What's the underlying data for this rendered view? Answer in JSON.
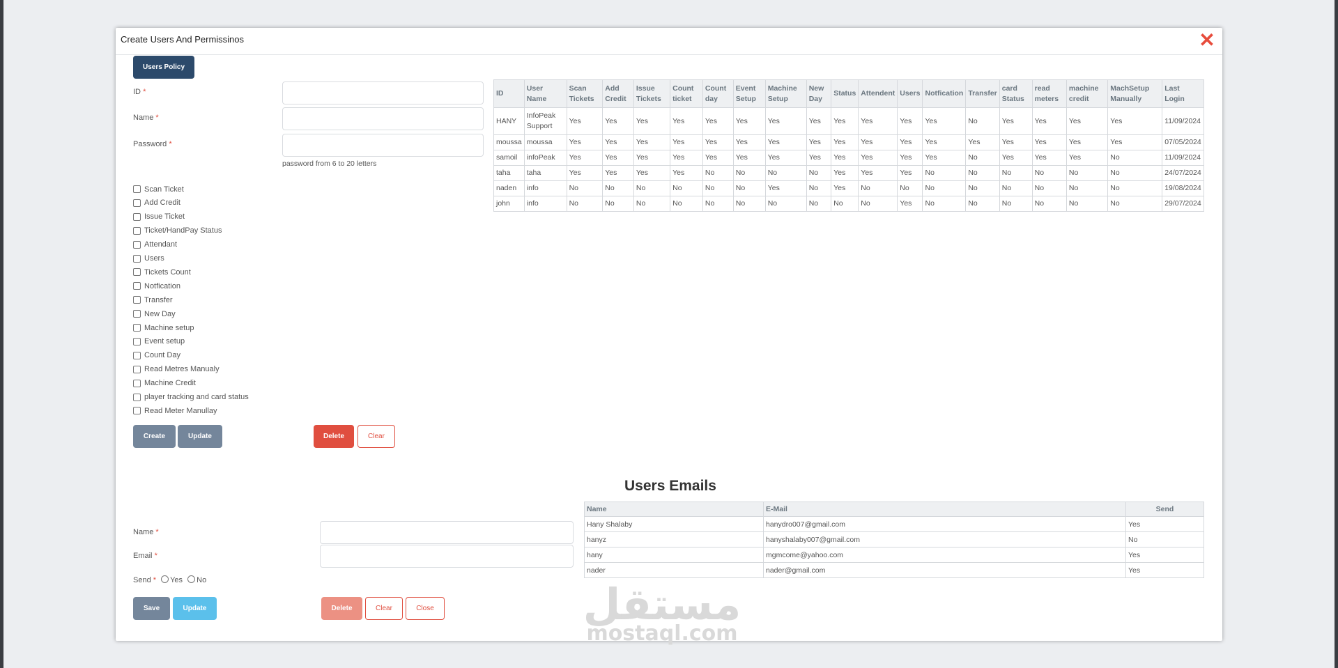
{
  "modal": {
    "title": "Create Users And Permissinos",
    "close_glyph": "✕"
  },
  "policy": {
    "tab_label": "Users Policy",
    "fields": {
      "id_label": "ID",
      "name_label": "Name",
      "password_label": "Password",
      "required_mark": "*",
      "password_hint": "password from 6 to 20 letters"
    },
    "permissions": [
      "Scan Ticket",
      "Add Credit",
      "Issue Ticket",
      "Ticket/HandPay Status",
      "Attendant",
      "Users",
      "Tickets Count",
      "Notfication",
      "Transfer",
      "New Day",
      "Machine setup",
      "Event setup",
      "Count Day",
      "Read Metres Manualy",
      "Machine Credit",
      "player tracking and card status",
      "Read Meter Manullay"
    ],
    "buttons": {
      "create": "Create",
      "update": "Update",
      "delete": "Delete",
      "clear": "Clear"
    }
  },
  "users_table": {
    "headers": [
      "ID",
      "User Name",
      "Scan Tickets",
      "Add Credit",
      "Issue Tickets",
      "Count ticket",
      "Count day",
      "Event Setup",
      "Machine Setup",
      "New Day",
      "Status",
      "Attendent",
      "Users",
      "Notfication",
      "Transfer",
      "card Status",
      "read meters",
      "machine credit",
      "MachSetup Manually",
      "Last Login"
    ],
    "rows": [
      [
        "HANY",
        "InfoPeak Support",
        "Yes",
        "Yes",
        "Yes",
        "Yes",
        "Yes",
        "Yes",
        "Yes",
        "Yes",
        "Yes",
        "Yes",
        "Yes",
        "Yes",
        "No",
        "Yes",
        "Yes",
        "Yes",
        "Yes",
        "11/09/2024"
      ],
      [
        "moussa",
        "moussa",
        "Yes",
        "Yes",
        "Yes",
        "Yes",
        "Yes",
        "Yes",
        "Yes",
        "Yes",
        "Yes",
        "Yes",
        "Yes",
        "Yes",
        "Yes",
        "Yes",
        "Yes",
        "Yes",
        "Yes",
        "07/05/2024"
      ],
      [
        "samoil",
        "infoPeak",
        "Yes",
        "Yes",
        "Yes",
        "Yes",
        "Yes",
        "Yes",
        "Yes",
        "Yes",
        "Yes",
        "Yes",
        "Yes",
        "Yes",
        "No",
        "Yes",
        "Yes",
        "Yes",
        "No",
        "11/09/2024"
      ],
      [
        "taha",
        "taha",
        "Yes",
        "Yes",
        "Yes",
        "Yes",
        "No",
        "No",
        "No",
        "No",
        "Yes",
        "Yes",
        "Yes",
        "No",
        "No",
        "No",
        "No",
        "No",
        "No",
        "24/07/2024"
      ],
      [
        "naden",
        "info",
        "No",
        "No",
        "No",
        "No",
        "No",
        "No",
        "Yes",
        "No",
        "Yes",
        "No",
        "No",
        "No",
        "No",
        "No",
        "No",
        "No",
        "No",
        "19/08/2024"
      ],
      [
        "john",
        "info",
        "No",
        "No",
        "No",
        "No",
        "No",
        "No",
        "No",
        "No",
        "No",
        "No",
        "Yes",
        "No",
        "No",
        "No",
        "No",
        "No",
        "No",
        "29/07/2024"
      ]
    ]
  },
  "emails": {
    "title": "Users Emails",
    "fields": {
      "name_label": "Name",
      "email_label": "Email",
      "send_label": "Send",
      "required_mark": "*",
      "yes_label": "Yes",
      "no_label": "No"
    },
    "buttons": {
      "save": "Save",
      "update": "Update",
      "delete": "Delete",
      "clear": "Clear",
      "close": "Close"
    },
    "table": {
      "headers": [
        "Name",
        "E-Mail",
        "Send"
      ],
      "rows": [
        [
          "Hany Shalaby",
          "hanydro007@gmail.com",
          "Yes"
        ],
        [
          "hanyz",
          "hanyshalaby007@gmail.com",
          "No"
        ],
        [
          "hany",
          "mgmcome@yahoo.com",
          "Yes"
        ],
        [
          "nader",
          "nader@gmail.com",
          "Yes"
        ]
      ]
    }
  },
  "watermark": {
    "logo_text": "مستقل",
    "site": "mostaql.com"
  }
}
